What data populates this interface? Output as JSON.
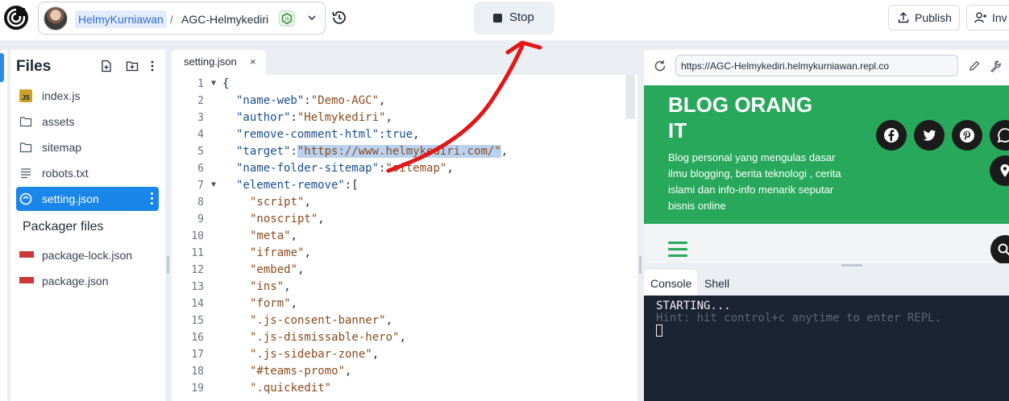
{
  "header": {
    "owner": "HelmyKurniawan",
    "separator": "/",
    "repl_name": "AGC-Helmykediri",
    "stop_label": "Stop",
    "publish_label": "Publish",
    "invite_label": "Inv"
  },
  "files": {
    "title": "Files",
    "items": [
      {
        "label": "index.js",
        "icon": "js-file-icon"
      },
      {
        "label": "assets",
        "icon": "folder-icon"
      },
      {
        "label": "sitemap",
        "icon": "folder-icon"
      },
      {
        "label": "robots.txt",
        "icon": "text-file-icon"
      },
      {
        "label": "setting.json",
        "icon": "json-file-icon",
        "active": true
      }
    ],
    "packager_title": "Packager files",
    "packager_items": [
      {
        "label": "package-lock.json",
        "icon": "npm-icon"
      },
      {
        "label": "package.json",
        "icon": "npm-icon"
      }
    ]
  },
  "editor": {
    "tab_label": "setting.json",
    "tab_close": "×",
    "line_numbers": [
      "1",
      "2",
      "3",
      "4",
      "5",
      "6",
      "7",
      "8",
      "9",
      "10",
      "11",
      "12",
      "13",
      "14",
      "15",
      "16",
      "17",
      "18",
      "19"
    ],
    "lines": {
      "l1": "{",
      "l2_key": "\"name-web\"",
      "l2_val": "\"Demo-AGC\"",
      "l3_key": "\"author\"",
      "l3_val": "\"Helmykediri\"",
      "l4_key": "\"remove-comment-html\"",
      "l4_val": "true",
      "l5_key": "\"target\"",
      "l5_val": "\"https://www.helmykediri.com/\"",
      "l6_key": "\"name-folder-sitemap\"",
      "l6_val": "\"sitemap\"",
      "l7_key": "\"element-remove\"",
      "l7_val": "[",
      "l8": "\"script\"",
      "l9": "\"noscript\"",
      "l10": "\"meta\"",
      "l11": "\"iframe\"",
      "l12": "\"embed\"",
      "l13": "\"ins\"",
      "l14": "\"form\"",
      "l15": "\".js-consent-banner\"",
      "l16": "\".js-dismissable-hero\"",
      "l17": "\".js-sidebar-zone\"",
      "l18": "\"#teams-promo\"",
      "l19": "\".quickedit\""
    }
  },
  "preview": {
    "url": "https://AGC-Helmykediri.helmykurniawan.repl.co",
    "blog_title": "BLOG ORANG IT",
    "blog_description": "Blog personal yang mengulas dasar ilmu blogging, berita teknologi , cerita islami dan info-info menarik seputar bisnis online",
    "accent_color": "#27a85a"
  },
  "console": {
    "tabs": [
      "Console",
      "Shell"
    ],
    "line1": "STARTING...",
    "line2": "Hint: hit control+c anytime to enter REPL."
  }
}
